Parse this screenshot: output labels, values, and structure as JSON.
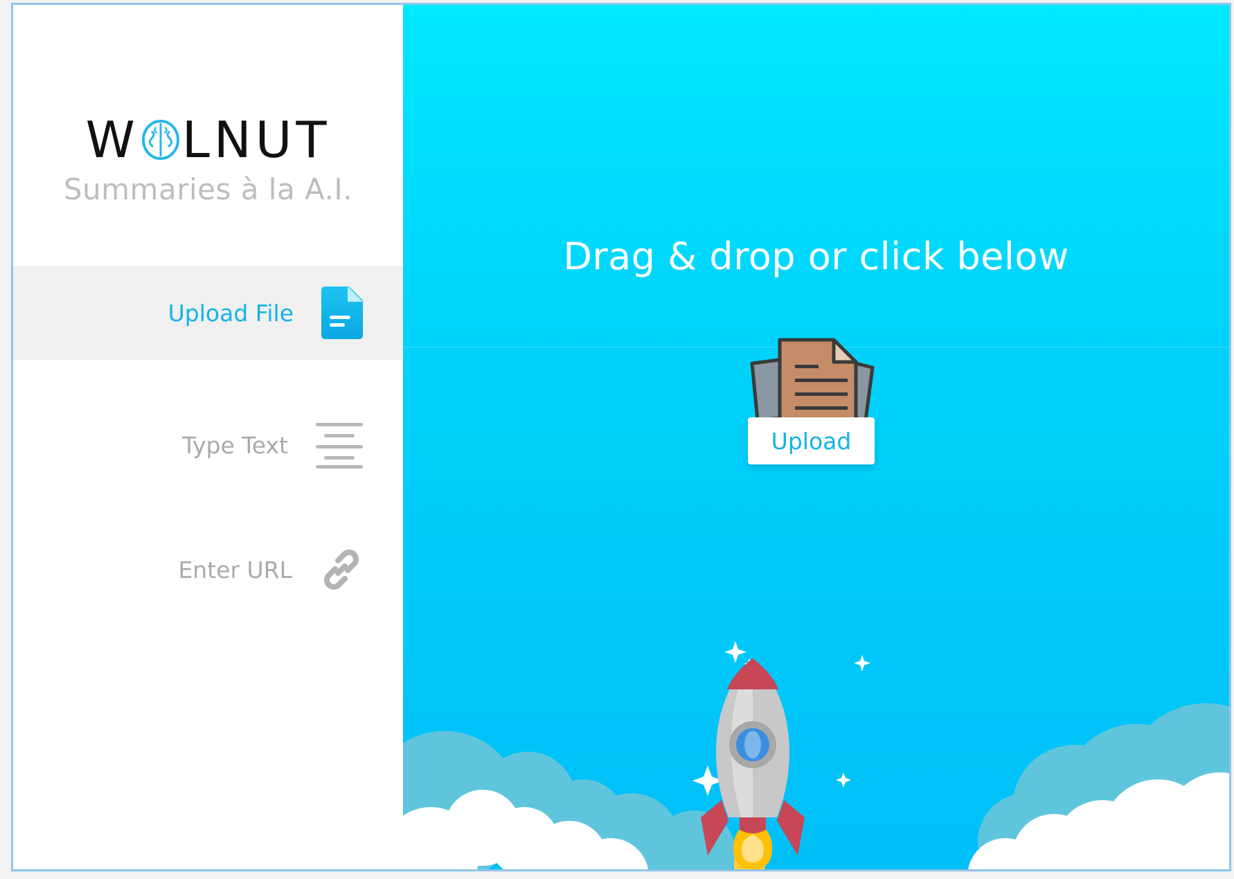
{
  "app": {
    "logo_letters_left": "W",
    "logo_letters_right": "LNUT",
    "tagline": "Summaries à la A.I."
  },
  "sidebar": {
    "items": [
      {
        "label": "Upload File",
        "icon": "document-icon",
        "active": true
      },
      {
        "label": "Type Text",
        "icon": "text-lines-icon",
        "active": false
      },
      {
        "label": "Enter URL",
        "icon": "link-icon",
        "active": false
      }
    ]
  },
  "main": {
    "headline": "Drag & drop or click below",
    "upload_label": "Upload"
  },
  "colors": {
    "accent": "#12b4e6",
    "main_top": "#00e9fe",
    "main_bottom": "#00bff8",
    "muted_text": "#aaaaaa"
  }
}
